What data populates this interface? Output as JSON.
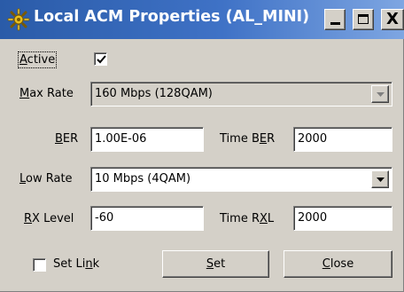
{
  "window": {
    "title": "Local ACM Properties (AL_MINI)",
    "title_buttons": {
      "minimize": "_",
      "maximize": "□",
      "close": "X"
    }
  },
  "colors": {
    "titlebar": "#2a5ba8",
    "face": "#d4d0c8",
    "field_bg": "#ffffff"
  },
  "active": {
    "label_hot": "A",
    "label_rest": "ctive",
    "checked": true
  },
  "max_rate": {
    "label_hot": "M",
    "label_rest": "ax Rate",
    "value": "160 Mbps (128QAM)",
    "enabled": false
  },
  "ber": {
    "label_hot": "B",
    "label_rest": "ER",
    "value": "1.00E-06"
  },
  "time_ber": {
    "label_pre": "Time B",
    "label_hot": "E",
    "label_rest": "R",
    "value": "2000"
  },
  "low_rate": {
    "label_hot": "L",
    "label_rest": "ow Rate",
    "value": "10 Mbps (4QAM)"
  },
  "rx_level": {
    "label_hot": "R",
    "label_rest": "X Level",
    "value": "-60"
  },
  "time_rxl": {
    "label_pre": "Time R",
    "label_hot": "X",
    "label_rest": "L",
    "value": "2000"
  },
  "set_link": {
    "label_pre": "Set Li",
    "label_hot": "n",
    "label_rest": "k",
    "checked": false
  },
  "buttons": {
    "set": {
      "label_hot": "S",
      "label_rest": "et"
    },
    "close": {
      "label_hot": "C",
      "label_rest": "lose"
    }
  }
}
